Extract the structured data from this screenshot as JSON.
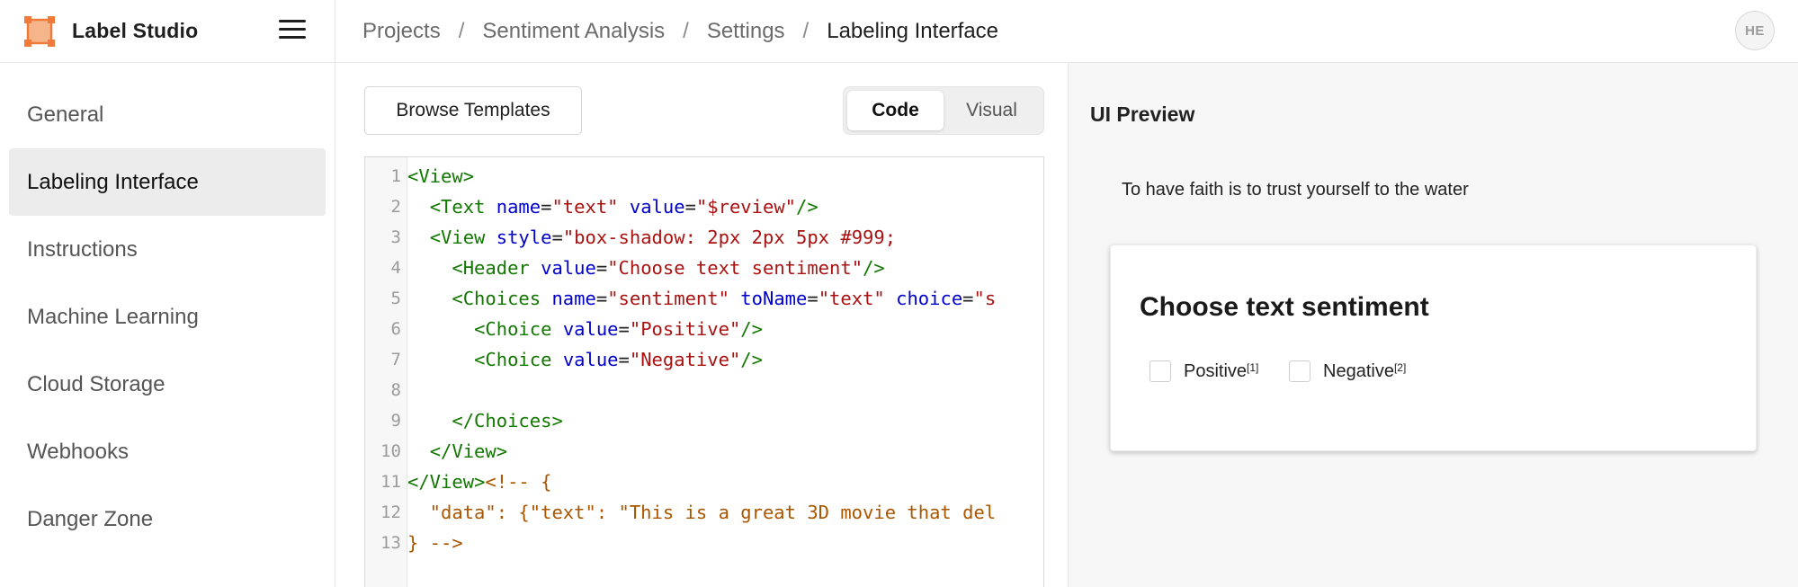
{
  "app": {
    "name": "Label Studio"
  },
  "breadcrumb": [
    "Projects",
    "Sentiment Analysis",
    "Settings",
    "Labeling Interface"
  ],
  "user": {
    "initials": "HE"
  },
  "sidebar": {
    "items": [
      {
        "label": "General"
      },
      {
        "label": "Labeling Interface"
      },
      {
        "label": "Instructions"
      },
      {
        "label": "Machine Learning"
      },
      {
        "label": "Cloud Storage"
      },
      {
        "label": "Webhooks"
      },
      {
        "label": "Danger Zone"
      }
    ],
    "active_index": 1
  },
  "editor": {
    "browse_label": "Browse Templates",
    "toggle": {
      "code": "Code",
      "visual": "Visual",
      "active": "code"
    },
    "lines": [
      "<View>",
      "  <Text name=\"text\" value=\"$review\"/>",
      "  <View style=\"box-shadow: 2px 2px 5px #999;",
      "    <Header value=\"Choose text sentiment\"/>",
      "    <Choices name=\"sentiment\" toName=\"text\" choice=\"s",
      "      <Choice value=\"Positive\"/>",
      "      <Choice value=\"Negative\"/>",
      "",
      "    </Choices>",
      "  </View>",
      "</View><!-- {",
      "  \"data\": {\"text\": \"This is a great 3D movie that del",
      "} -->"
    ]
  },
  "preview": {
    "title": "UI Preview",
    "text": "To have faith is to trust yourself to the water",
    "header": "Choose text sentiment",
    "choices": [
      {
        "label": "Positive",
        "hotkey": "[1]"
      },
      {
        "label": "Negative",
        "hotkey": "[2]"
      }
    ]
  },
  "colors": {
    "logo": "#f07a3a",
    "tag": "#117700",
    "attr": "#0000cc",
    "string": "#aa1111",
    "comment": "#aa5500"
  }
}
